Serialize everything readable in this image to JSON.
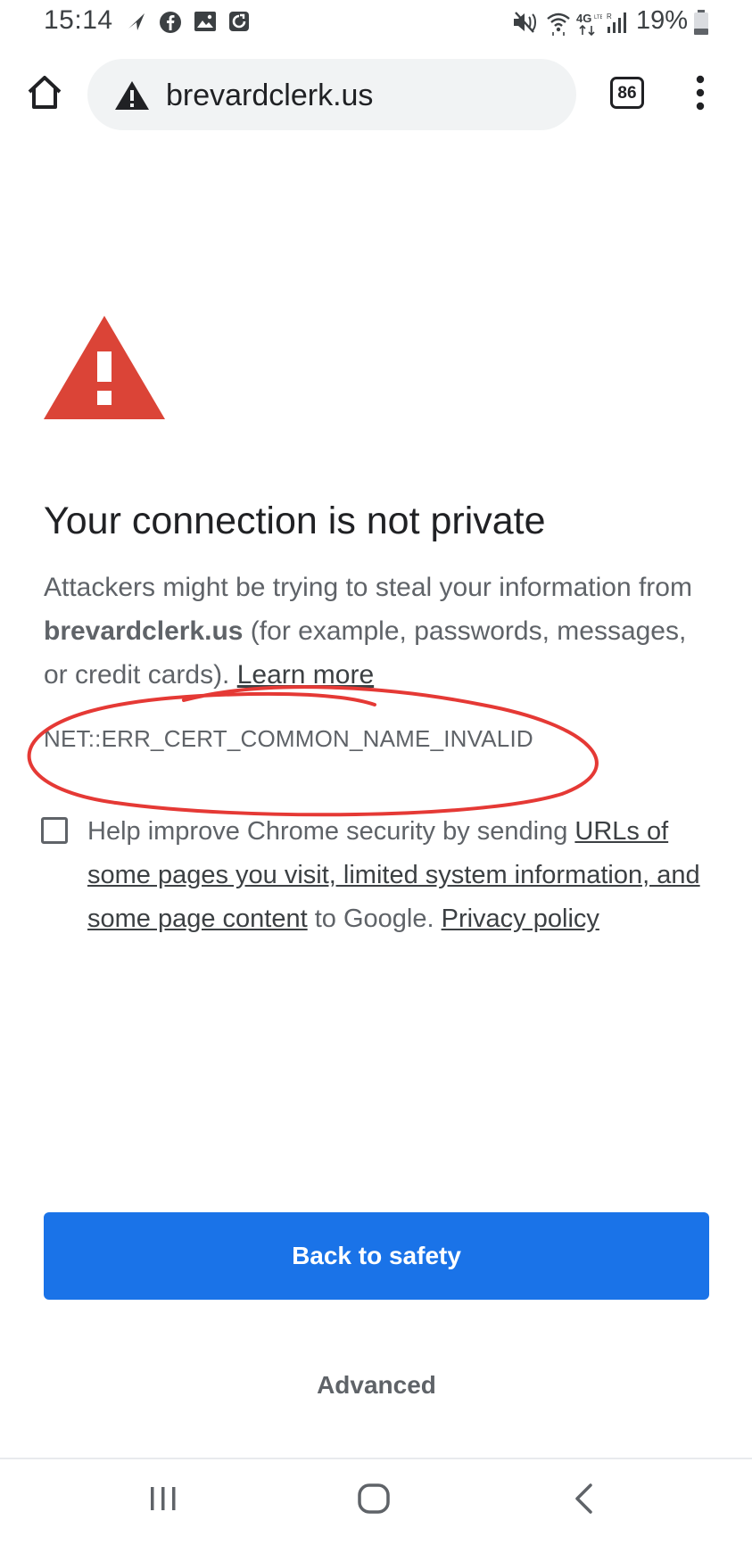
{
  "status_bar": {
    "time": "15:14",
    "battery_percent": "19%",
    "icons": [
      "location-arrow-icon",
      "facebook-icon",
      "gallery-icon",
      "app-notification-icon",
      "mute-icon",
      "wifi-icon",
      "4g-lte-icon",
      "signal-icon",
      "battery-icon"
    ]
  },
  "toolbar": {
    "url": "brevardclerk.us",
    "tab_count": "86",
    "icons": [
      "home-icon",
      "warning-triangle-icon",
      "tab-switcher-icon",
      "more-vert-icon"
    ]
  },
  "interstitial": {
    "heading": "Your connection is not private",
    "body_pre": "Attackers might be trying to steal your information from ",
    "body_domain": "brevardclerk.us",
    "body_post": " (for example, passwords, messages, or credit cards). ",
    "learn_more": "Learn more",
    "error_code": "NET::ERR_CERT_COMMON_NAME_INVALID",
    "annotation_color": "#e53935",
    "warning_color": "#db4437"
  },
  "opt_in": {
    "checked": "false",
    "pre": "Help improve Chrome security by sending ",
    "link": "URLs of some pages you visit, limited system information, and some page content",
    "mid": " to Google. ",
    "privacy_link": "Privacy policy"
  },
  "buttons": {
    "back_to_safety": "Back to safety",
    "advanced": "Advanced",
    "primary_color": "#1a73e8"
  },
  "nav_bar": {
    "icons": [
      "recent-apps-icon",
      "home-nav-icon",
      "back-icon"
    ]
  }
}
